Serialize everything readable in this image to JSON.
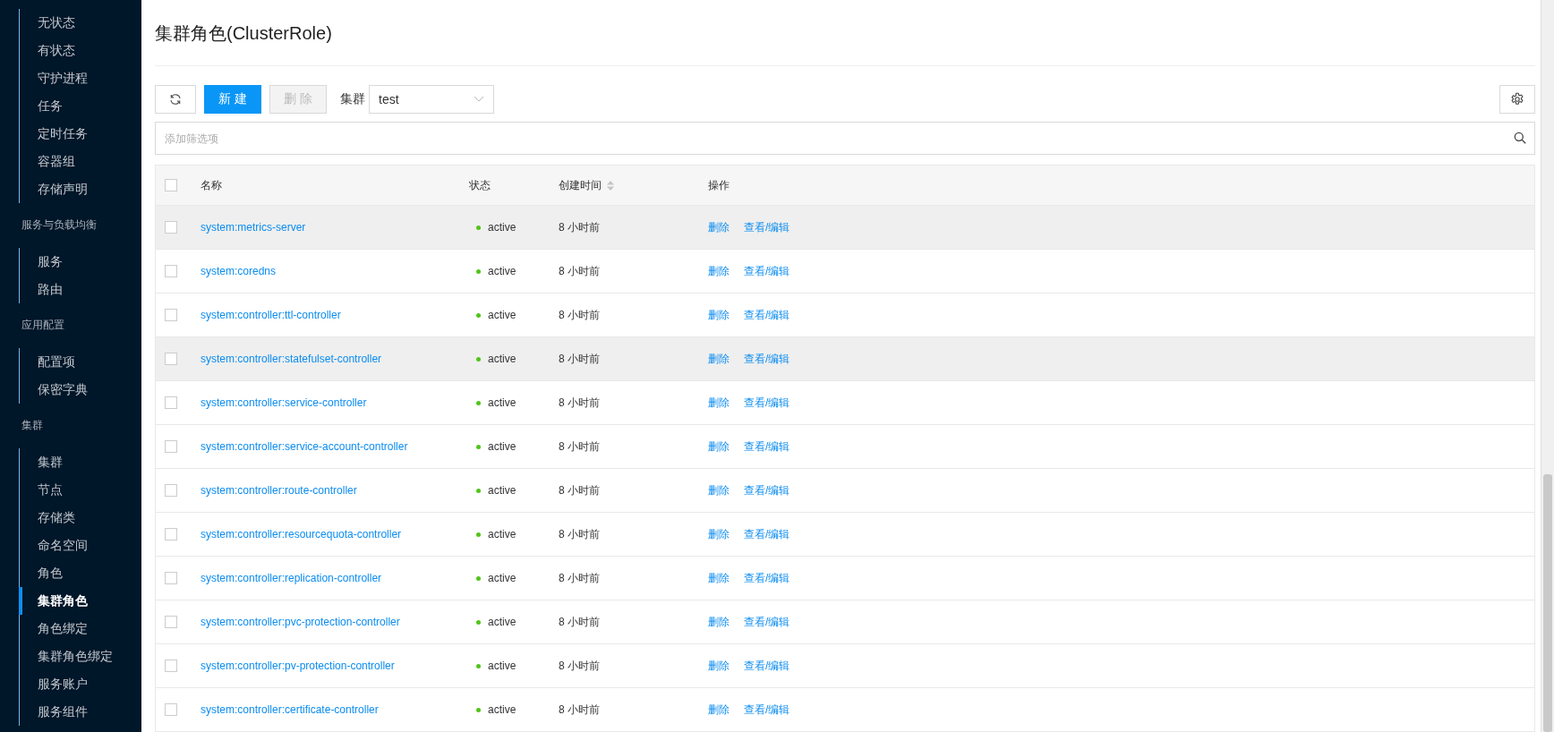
{
  "sidebar": {
    "sections": [
      {
        "items": [
          {
            "label": "无状态",
            "selected": false
          },
          {
            "label": "有状态",
            "selected": false
          },
          {
            "label": "守护进程",
            "selected": false
          },
          {
            "label": "任务",
            "selected": false
          },
          {
            "label": "定时任务",
            "selected": false
          },
          {
            "label": "容器组",
            "selected": false
          },
          {
            "label": "存储声明",
            "selected": false
          }
        ]
      },
      {
        "label": "服务与负载均衡",
        "items": [
          {
            "label": "服务",
            "selected": false
          },
          {
            "label": "路由",
            "selected": false
          }
        ]
      },
      {
        "label": "应用配置",
        "items": [
          {
            "label": "配置项",
            "selected": false
          },
          {
            "label": "保密字典",
            "selected": false
          }
        ]
      },
      {
        "label": "集群",
        "items": [
          {
            "label": "集群",
            "selected": false
          },
          {
            "label": "节点",
            "selected": false
          },
          {
            "label": "存储类",
            "selected": false
          },
          {
            "label": "命名空间",
            "selected": false
          },
          {
            "label": "角色",
            "selected": false
          },
          {
            "label": "集群角色",
            "selected": true
          },
          {
            "label": "角色绑定",
            "selected": false
          },
          {
            "label": "集群角色绑定",
            "selected": false
          },
          {
            "label": "服务账户",
            "selected": false
          },
          {
            "label": "服务组件",
            "selected": false
          }
        ]
      }
    ]
  },
  "page_title": "集群角色(ClusterRole)",
  "toolbar": {
    "new_button": "新 建",
    "delete_button": {
      "label": "删 除",
      "disabled": true
    },
    "cluster_label": "集群",
    "cluster_select": "test"
  },
  "filter": {
    "placeholder": "添加筛选项"
  },
  "table": {
    "header_checked": false,
    "columns": [
      {
        "label": "名称",
        "sortable": false
      },
      {
        "label": "状态",
        "sortable": false
      },
      {
        "label": "创建时间",
        "sortable": true
      },
      {
        "label": "操作",
        "sortable": false
      }
    ],
    "rows": [
      {
        "name": "system:metrics-server",
        "status": "active",
        "age": "8 小时前",
        "actions": [
          "删除",
          "查看/编辑"
        ],
        "checked": false,
        "highlighted": true
      },
      {
        "name": "system:coredns",
        "status": "active",
        "age": "8 小时前",
        "actions": [
          "删除",
          "查看/编辑"
        ],
        "checked": false,
        "highlighted": false
      },
      {
        "name": "system:controller:ttl-controller",
        "status": "active",
        "age": "8 小时前",
        "actions": [
          "删除",
          "查看/编辑"
        ],
        "checked": false,
        "highlighted": false
      },
      {
        "name": "system:controller:statefulset-controller",
        "status": "active",
        "age": "8 小时前",
        "actions": [
          "删除",
          "查看/编辑"
        ],
        "checked": false,
        "highlighted": true
      },
      {
        "name": "system:controller:service-controller",
        "status": "active",
        "age": "8 小时前",
        "actions": [
          "删除",
          "查看/编辑"
        ],
        "checked": false,
        "highlighted": false
      },
      {
        "name": "system:controller:service-account-controller",
        "status": "active",
        "age": "8 小时前",
        "actions": [
          "删除",
          "查看/编辑"
        ],
        "checked": false,
        "highlighted": false
      },
      {
        "name": "system:controller:route-controller",
        "status": "active",
        "age": "8 小时前",
        "actions": [
          "删除",
          "查看/编辑"
        ],
        "checked": false,
        "highlighted": false
      },
      {
        "name": "system:controller:resourcequota-controller",
        "status": "active",
        "age": "8 小时前",
        "actions": [
          "删除",
          "查看/编辑"
        ],
        "checked": false,
        "highlighted": false
      },
      {
        "name": "system:controller:replication-controller",
        "status": "active",
        "age": "8 小时前",
        "actions": [
          "删除",
          "查看/编辑"
        ],
        "checked": false,
        "highlighted": false
      },
      {
        "name": "system:controller:pvc-protection-controller",
        "status": "active",
        "age": "8 小时前",
        "actions": [
          "删除",
          "查看/编辑"
        ],
        "checked": false,
        "highlighted": false
      },
      {
        "name": "system:controller:pv-protection-controller",
        "status": "active",
        "age": "8 小时前",
        "actions": [
          "删除",
          "查看/编辑"
        ],
        "checked": false,
        "highlighted": false
      },
      {
        "name": "system:controller:certificate-controller",
        "status": "active",
        "age": "8 小时前",
        "actions": [
          "删除",
          "查看/编辑"
        ],
        "checked": false,
        "highlighted": false
      }
    ]
  }
}
